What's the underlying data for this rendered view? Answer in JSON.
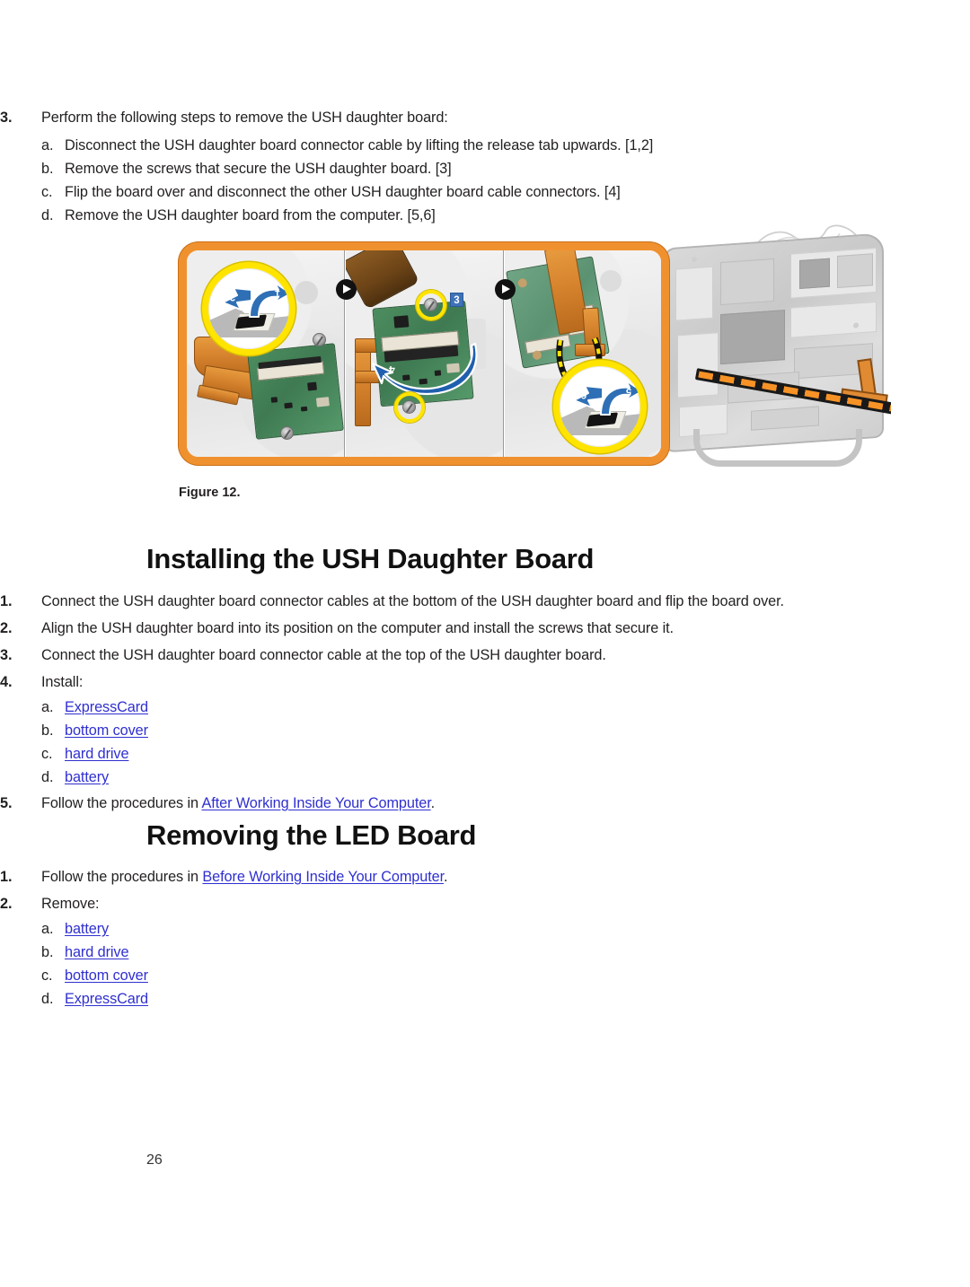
{
  "page": {
    "number": "26",
    "accent_orange": "#f0912f",
    "link_color": "#2f2fd0",
    "callout_yellow": "#ffe400",
    "blue_label": "#3e72b8"
  },
  "removal_steps": {
    "step3": {
      "marker": "3.",
      "text": "Perform the following steps to remove the USH daughter board:",
      "substeps": [
        {
          "marker": "a.",
          "text": "Disconnect the USH daughter board connector cable by lifting the release tab upwards. [1,2]"
        },
        {
          "marker": "b.",
          "text": "Remove the screws that secure the USH daughter board. [3]"
        },
        {
          "marker": "c.",
          "text": "Flip the board over and disconnect the other USH daughter board cable connectors. [4]"
        },
        {
          "marker": "d.",
          "text": "Remove the USH daughter board from the computer. [5,6]"
        }
      ]
    }
  },
  "figure": {
    "caption": "Figure 12.",
    "callout_numbers": [
      "1",
      "2",
      "3",
      "4",
      "5",
      "6"
    ],
    "panel_count": 3
  },
  "section_installing": {
    "heading": "Installing the USH Daughter Board",
    "steps": [
      {
        "marker": "1.",
        "text": "Connect the USH daughter board connector cables at the bottom of the USH daughter board and flip the board over."
      },
      {
        "marker": "2.",
        "text": "Align the USH daughter board into its position on the computer and install the screws that secure it."
      },
      {
        "marker": "3.",
        "text": "Connect the USH daughter board connector cable at the top of the USH daughter board."
      },
      {
        "marker": "4.",
        "text": "Install:"
      }
    ],
    "install_items": [
      {
        "marker": "a.",
        "link": "ExpressCard"
      },
      {
        "marker": "b.",
        "link": "bottom cover"
      },
      {
        "marker": "c.",
        "link": "hard drive"
      },
      {
        "marker": "d.",
        "link": "battery"
      }
    ],
    "step5": {
      "marker": "5.",
      "prefix": "Follow the procedures in ",
      "link": "After Working Inside Your Computer",
      "suffix": "."
    }
  },
  "section_removing_led": {
    "heading": "Removing the LED Board",
    "step1": {
      "marker": "1.",
      "prefix": "Follow the procedures in ",
      "link": "Before Working Inside Your Computer",
      "suffix": "."
    },
    "step2": {
      "marker": "2.",
      "text": "Remove:"
    },
    "remove_items": [
      {
        "marker": "a.",
        "link": "battery"
      },
      {
        "marker": "b.",
        "link": "hard drive"
      },
      {
        "marker": "c.",
        "link": "bottom cover"
      },
      {
        "marker": "d.",
        "link": "ExpressCard"
      }
    ]
  }
}
